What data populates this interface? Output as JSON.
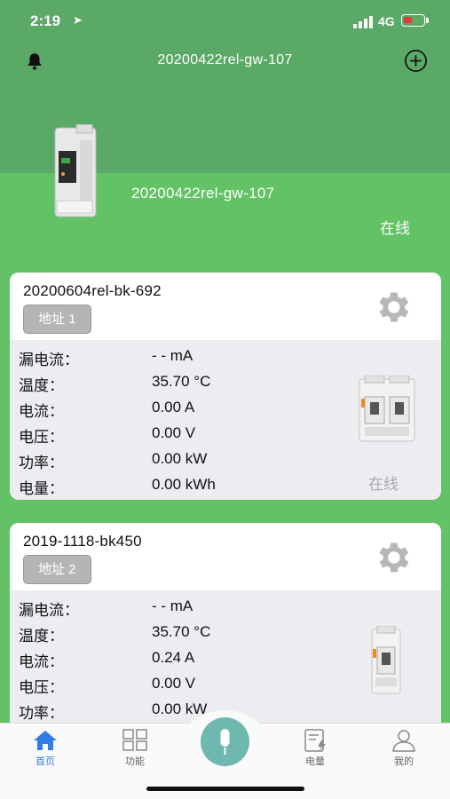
{
  "status_bar": {
    "time": "2:19",
    "network": "4G",
    "battery_color": "#e53935"
  },
  "header": {
    "title": "20200422rel-gw-107"
  },
  "gateway": {
    "name": "20200422rel-gw-107",
    "status": "在线"
  },
  "devices": [
    {
      "name": "20200604rel-bk-692",
      "address": "地址 1",
      "status": "在线",
      "metrics": [
        {
          "label": "漏电流：",
          "value": "- - mA"
        },
        {
          "label": "温度：",
          "value": "35.70 °C"
        },
        {
          "label": "电流：",
          "value": "0.00 A"
        },
        {
          "label": "电压：",
          "value": "0.00 V"
        },
        {
          "label": "功率：",
          "value": "0.00 kW"
        },
        {
          "label": "电量：",
          "value": "0.00 kWh"
        }
      ]
    },
    {
      "name": "2019-1118-bk450",
      "address": "地址 2",
      "metrics": [
        {
          "label": "漏电流：",
          "value": "- - mA"
        },
        {
          "label": "温度：",
          "value": "35.70 °C"
        },
        {
          "label": "电流：",
          "value": "0.24 A"
        },
        {
          "label": "电压：",
          "value": "0.00 V"
        },
        {
          "label": "功率：",
          "value": "0.00 kW"
        }
      ]
    }
  ],
  "tabs": [
    {
      "label": "首页",
      "icon": "home-icon",
      "active": true
    },
    {
      "label": "功能",
      "icon": "grid-icon"
    },
    {
      "label": "",
      "icon": "microphone-icon"
    },
    {
      "label": "电量",
      "icon": "energy-report-icon"
    },
    {
      "label": "我的",
      "icon": "user-icon"
    }
  ],
  "colors": {
    "header_green": "#5aa966",
    "page_green": "#63c266",
    "accent_blue": "#2f7ee6",
    "mic_teal": "#6fb8b0"
  }
}
